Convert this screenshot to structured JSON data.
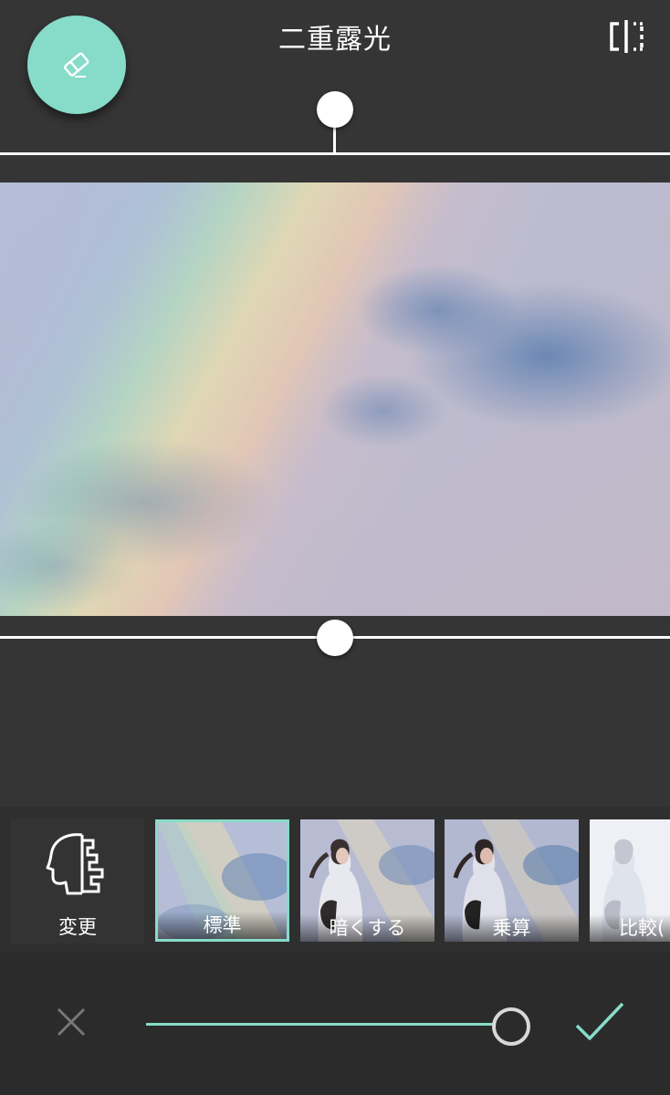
{
  "header": {
    "title": "二重露光",
    "eraser_icon": "eraser-icon",
    "compare_icon": "compare-split-icon"
  },
  "top_slider": {
    "value": 0.5
  },
  "bottom_slider": {
    "value": 0.5
  },
  "filter_strip": {
    "change_label": "変更",
    "change_icon": "face-profile-icon",
    "items": [
      {
        "label": "標準",
        "selected": true
      },
      {
        "label": "暗くする",
        "selected": false
      },
      {
        "label": "乗算",
        "selected": false
      },
      {
        "label": "比較(",
        "selected": false
      }
    ]
  },
  "bottom_bar": {
    "cancel_icon": "close-icon",
    "confirm_icon": "checkmark-icon",
    "opacity": 1.0
  },
  "colors": {
    "accent": "#86dcc9",
    "background": "#353535",
    "strip": "#2f2f2f",
    "bottom_bar": "#2b2b2b"
  }
}
